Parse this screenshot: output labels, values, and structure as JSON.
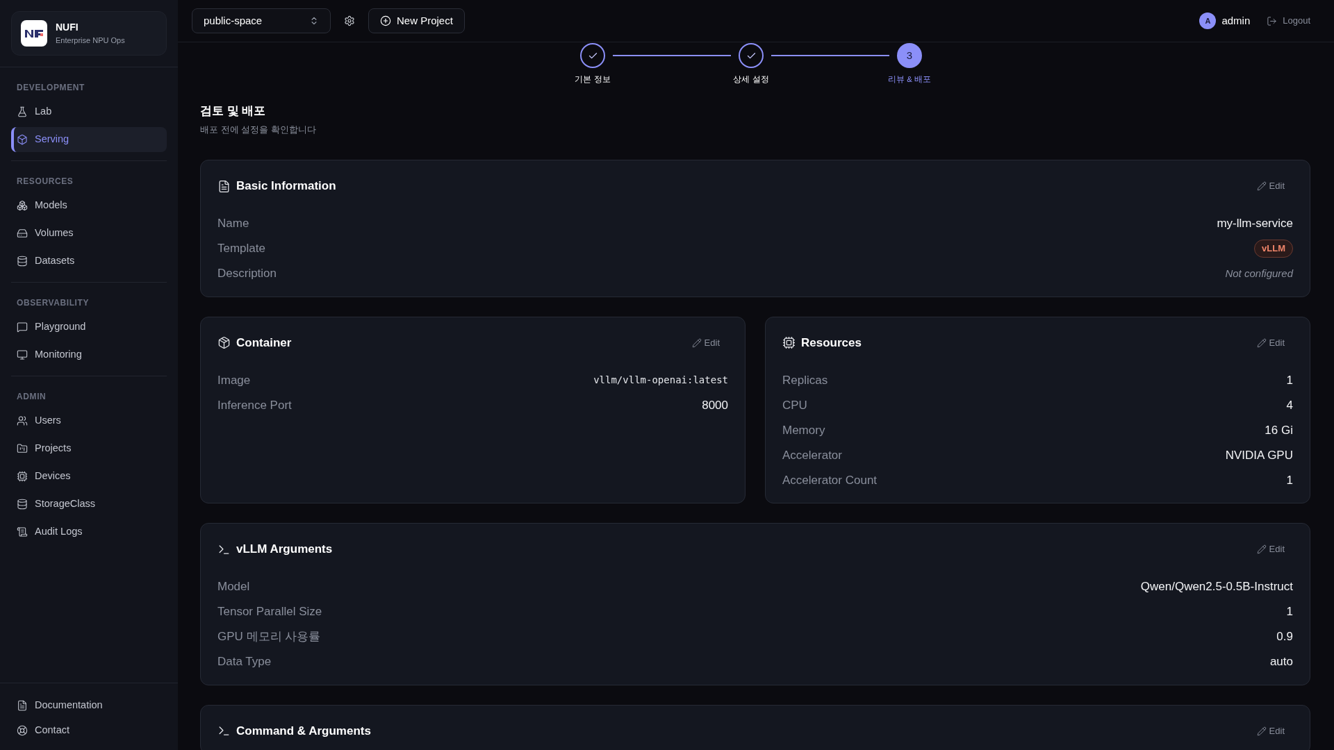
{
  "brand": {
    "name": "NUFI",
    "subtitle": "Enterprise NPU Ops"
  },
  "sidebar": {
    "sections": [
      {
        "title": "DEVELOPMENT",
        "items": [
          {
            "label": "Lab",
            "selected": false
          },
          {
            "label": "Serving",
            "selected": true
          }
        ]
      },
      {
        "title": "RESOURCES",
        "items": [
          {
            "label": "Models",
            "selected": false
          },
          {
            "label": "Volumes",
            "selected": false
          },
          {
            "label": "Datasets",
            "selected": false
          }
        ]
      },
      {
        "title": "OBSERVABILITY",
        "items": [
          {
            "label": "Playground",
            "selected": false
          },
          {
            "label": "Monitoring",
            "selected": false
          }
        ]
      },
      {
        "title": "ADMIN",
        "items": [
          {
            "label": "Users",
            "selected": false
          },
          {
            "label": "Projects",
            "selected": false
          },
          {
            "label": "Devices",
            "selected": false
          },
          {
            "label": "StorageClass",
            "selected": false
          },
          {
            "label": "Audit Logs",
            "selected": false
          }
        ]
      }
    ],
    "footer": [
      {
        "label": "Documentation"
      },
      {
        "label": "Contact"
      }
    ]
  },
  "topbar": {
    "project": "public-space",
    "new_project": "New Project",
    "user": {
      "initial": "A",
      "name": "admin"
    },
    "logout": "Logout"
  },
  "stepper": [
    {
      "label": "기본 정보",
      "completed": true,
      "selected": false
    },
    {
      "label": "상세 설정",
      "completed": true,
      "selected": false
    },
    {
      "number": "3",
      "label": "리뷰 & 배포",
      "completed": false,
      "selected": true
    }
  ],
  "page": {
    "title": "검토 및 배포",
    "subtitle": "배포 전에 설정을 확인합니다"
  },
  "cards": [
    {
      "title": "Basic Information",
      "edit": "Edit",
      "rows": [
        {
          "label": "Name",
          "value": "my-llm-service",
          "kind": "text"
        },
        {
          "label": "Template",
          "value": "vLLM",
          "kind": "badge"
        },
        {
          "label": "Description",
          "value": "Not configured",
          "kind": "unset"
        }
      ]
    },
    {
      "title": "Container",
      "edit": "Edit",
      "rows": [
        {
          "label": "Image",
          "value": "vllm/vllm-openai:latest",
          "kind": "mono"
        },
        {
          "label": "Inference Port",
          "value": "8000",
          "kind": "text"
        }
      ]
    },
    {
      "title": "Resources",
      "edit": "Edit",
      "rows": [
        {
          "label": "Replicas",
          "value": "1",
          "kind": "text"
        },
        {
          "label": "CPU",
          "value": "4",
          "kind": "text"
        },
        {
          "label": "Memory",
          "value": "16 Gi",
          "kind": "text"
        },
        {
          "label": "Accelerator",
          "value": "NVIDIA GPU",
          "kind": "text"
        },
        {
          "label": "Accelerator Count",
          "value": "1",
          "kind": "text"
        }
      ]
    },
    {
      "title": "vLLM Arguments",
      "edit": "Edit",
      "rows": [
        {
          "label": "Model",
          "value": "Qwen/Qwen2.5-0.5B-Instruct",
          "kind": "text"
        },
        {
          "label": "Tensor Parallel Size",
          "value": "1",
          "kind": "text"
        },
        {
          "label": "GPU 메모리 사용률",
          "value": "0.9",
          "kind": "text"
        },
        {
          "label": "Data Type",
          "value": "auto",
          "kind": "text"
        }
      ]
    },
    {
      "title": "Command & Arguments",
      "edit": "Edit"
    }
  ]
}
